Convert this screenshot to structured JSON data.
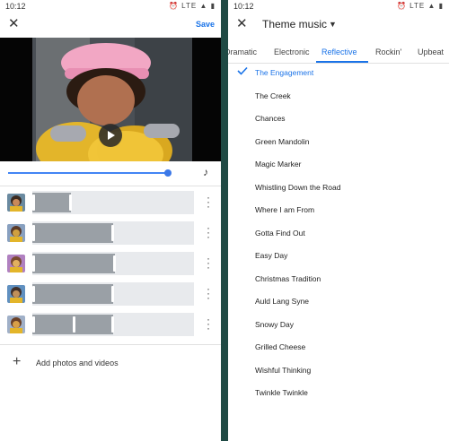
{
  "status": {
    "time_left": "10:12",
    "time_right": "10:12",
    "icons": "⏰ LTE ▲ ▮"
  },
  "editor": {
    "save_label": "Save",
    "add_label": "Add photos and videos",
    "progress": 0.8,
    "clips": [
      {
        "segments": [
          [
            0,
            0.24
          ]
        ],
        "handles": [
          0.0,
          0.24
        ]
      },
      {
        "segments": [
          [
            0,
            0.5
          ]
        ],
        "handles": [
          0.0,
          0.5
        ]
      },
      {
        "segments": [
          [
            0,
            0.51
          ]
        ],
        "handles": [
          0.0,
          0.51
        ]
      },
      {
        "segments": [
          [
            0,
            0.5
          ]
        ],
        "handles": [
          0.0,
          0.5
        ]
      },
      {
        "segments": [
          [
            0,
            0.5
          ]
        ],
        "handles": [
          0.0,
          0.26,
          0.5
        ]
      }
    ]
  },
  "music": {
    "title": "Theme music",
    "tabs": [
      "Dramatic",
      "Electronic",
      "Reflective",
      "Rockin'",
      "Upbeat"
    ],
    "active_tab": "Reflective",
    "selected_song": "The Engagement",
    "songs": [
      "The Engagement",
      "The Creek",
      "Chances",
      "Green Mandolin",
      "Magic Marker",
      "Whistling Down the Road",
      "Where I am From",
      "Gotta Find Out",
      "Easy Day",
      "Christmas Tradition",
      "Auld Lang Syne",
      "Snowy Day",
      "Grilled Cheese",
      "Wishful Thinking",
      "Twinkle Twinkle"
    ]
  },
  "colors": {
    "accent": "#1a73e8",
    "divider": "#1f4a44"
  }
}
